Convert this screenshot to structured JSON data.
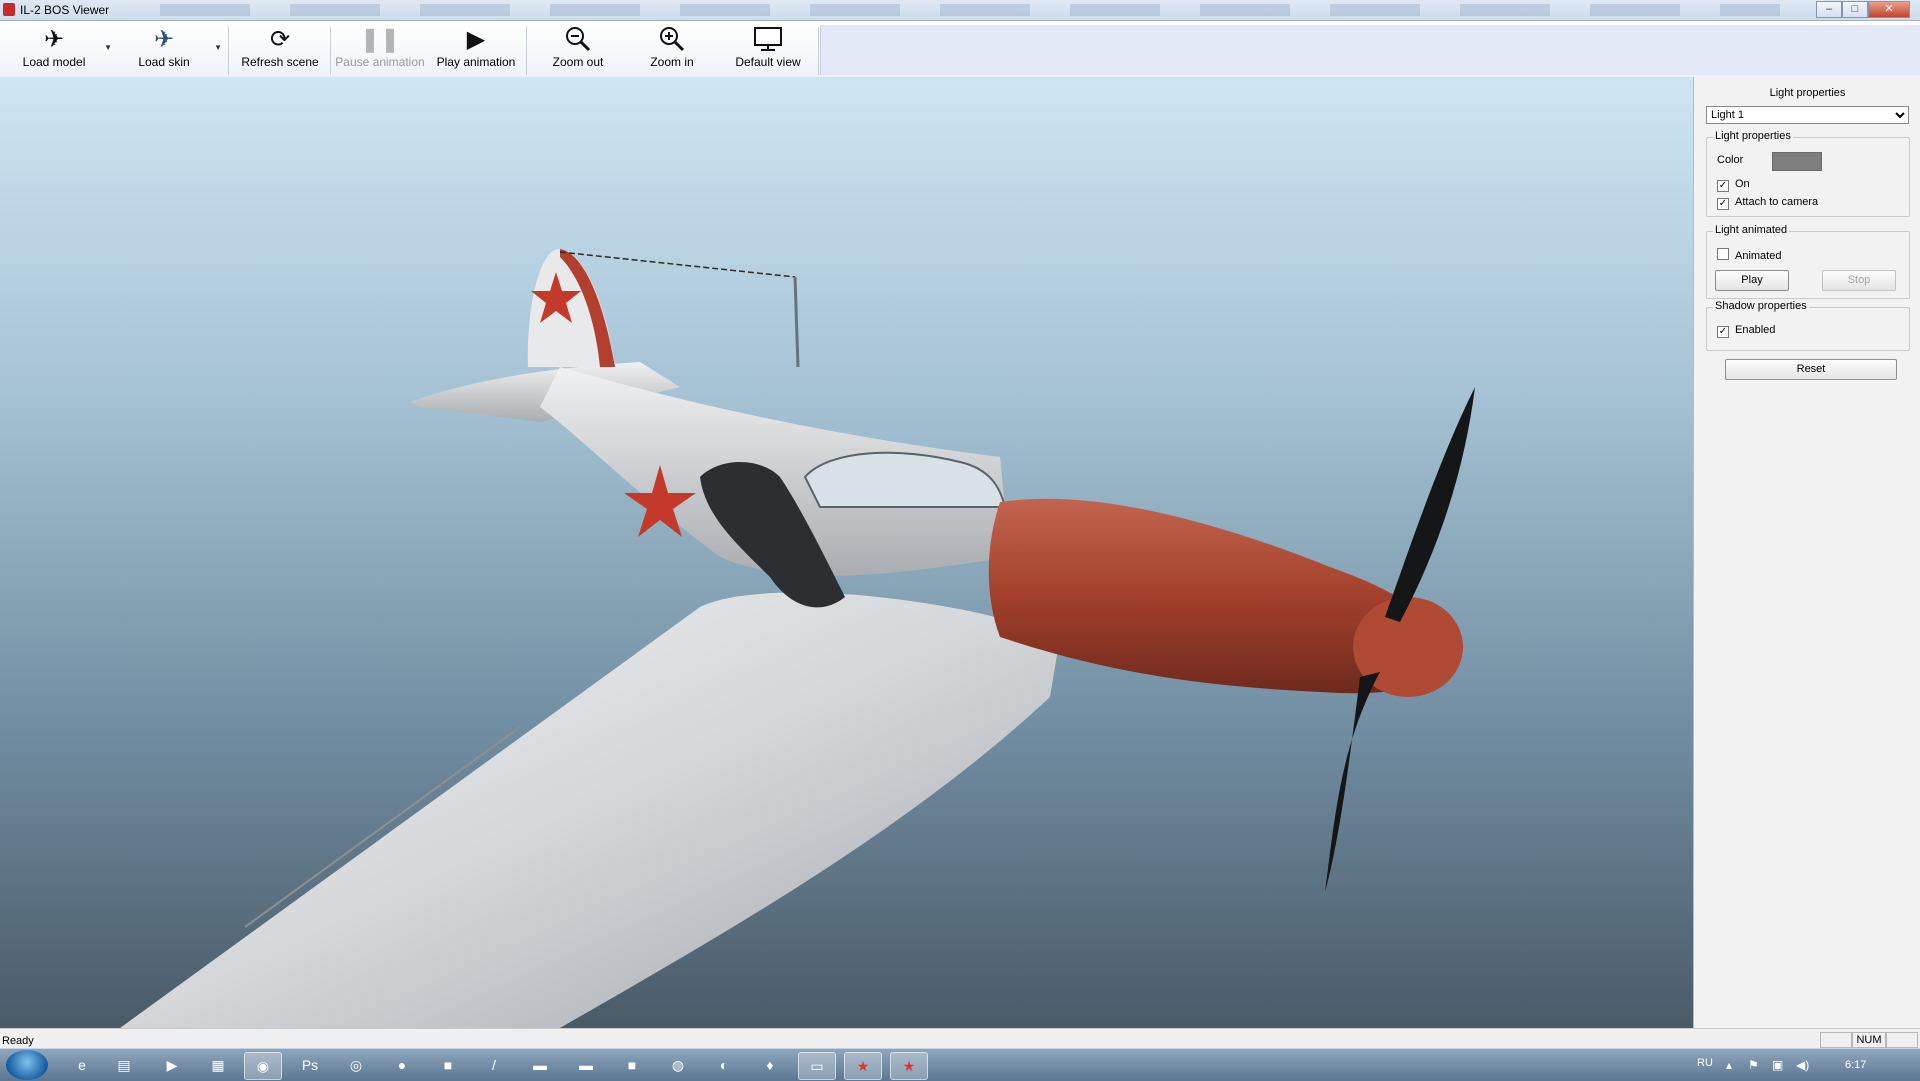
{
  "window": {
    "title": "IL-2 BOS Viewer",
    "controls": {
      "minimize": "–",
      "maximize": "□",
      "close": "✕"
    }
  },
  "toolbar": {
    "load_model": "Load model",
    "load_skin": "Load skin",
    "refresh_scene": "Refresh scene",
    "pause_animation": "Pause animation",
    "play_animation": "Play animation",
    "zoom_out": "Zoom out",
    "zoom_in": "Zoom in",
    "default_view": "Default view",
    "icons": {
      "load_model": "plane-icon",
      "load_skin": "plane-skin-icon",
      "refresh": "refresh-icon",
      "pause": "pause-icon",
      "play": "play-icon",
      "zoom_out": "zoom-out-icon",
      "zoom_in": "zoom-in-icon",
      "default_view": "monitor-icon"
    }
  },
  "panel": {
    "title": "Light properties",
    "light_select": {
      "selected": "Light 1"
    },
    "light_props": {
      "legend": "Light properties",
      "color_label": "Color",
      "color_value": "#7e7e7e",
      "on_label": "On",
      "on_checked": true,
      "attach_label": "Attach to camera",
      "attach_checked": true
    },
    "light_animated": {
      "legend": "Light animated",
      "animated_label": "Animated",
      "animated_checked": false,
      "play": "Play",
      "stop": "Stop"
    },
    "shadow": {
      "legend": "Shadow properties",
      "enabled_label": "Enabled",
      "enabled_checked": true
    },
    "reset": "Reset"
  },
  "status": {
    "text": "Ready",
    "num": "NUM"
  },
  "taskbar": {
    "language": "RU",
    "time": "6:17",
    "apps": [
      "ie-icon",
      "explorer-icon",
      "media-icon",
      "archive-icon",
      "firefox-icon",
      "photoshop-icon",
      "steam-icon",
      "origin-icon",
      "minecraft-icon",
      "pen-icon",
      "game-icon",
      "game2-icon",
      "app-icon",
      "globe-icon",
      "app2-icon",
      "shield-icon",
      "terminal-icon",
      "il2-icon",
      "il2-viewer-icon"
    ]
  },
  "colors": {
    "fuselage": "#e2e4e6",
    "nose": "#a8402d",
    "star": "#c33a2a",
    "accent_blue": "#1a5fa2"
  }
}
